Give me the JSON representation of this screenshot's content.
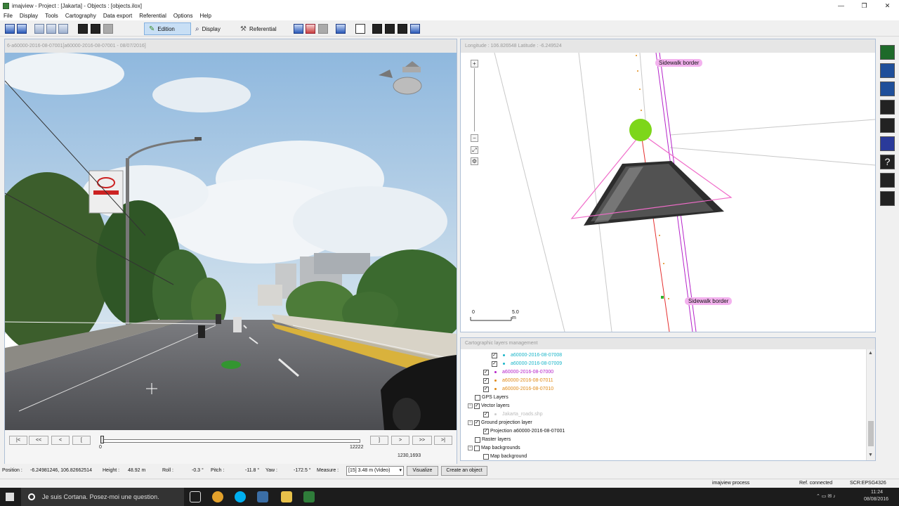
{
  "window": {
    "title": "imajview - Project : [Jakarta] - Objects : [objects.ilox]",
    "controls": [
      "—",
      "❐",
      "✕"
    ]
  },
  "menu": [
    "File",
    "Display",
    "Tools",
    "Cartography",
    "Data export",
    "Referential",
    "Options",
    "Help"
  ],
  "toolbar": {
    "edition_label": "Edition",
    "display_label": "Display",
    "referential_label": "Referential"
  },
  "left_panel": {
    "header": "6-a60000-2016-08-07001[a60000-2016-08-07001 - 08/07/2016]",
    "nav": [
      "|<",
      "<<",
      "<",
      "[",
      "]",
      ">",
      ">>",
      ">|"
    ],
    "slider_min": "0",
    "slider_max": "12222",
    "coords": "1230,1693",
    "frame_progress": 0.0
  },
  "map_panel": {
    "header": "Longitude : 106.826548 Latitude : -6.249524",
    "labels": [
      "Sidewalk border",
      "Sidewalk border"
    ],
    "scale_start": "0",
    "scale_end": "5.0",
    "scale_unit": "m"
  },
  "layers": {
    "header": "Cartographic layers management",
    "rows": [
      {
        "text": "a60000-2016-08-07008",
        "checked": true,
        "color": "#19b5c9"
      },
      {
        "text": "a60000-2016-08-07009",
        "checked": true,
        "color": "#19b5c9"
      },
      {
        "text": "a60000-2016-08-07000",
        "checked": true,
        "color": "#b522c9"
      },
      {
        "text": "a60000-2016-08-07011",
        "checked": true,
        "color": "#e08a16"
      },
      {
        "text": "a60000-2016-08-07010",
        "checked": true,
        "color": "#e08a16"
      },
      {
        "text": "GPS Layers",
        "checked": false
      },
      {
        "text": "Vector layers",
        "checked": true
      },
      {
        "text": "Jakarta_roads.shp",
        "checked": true,
        "color": "#bbbbbb"
      },
      {
        "text": "Ground projection layer",
        "checked": true
      },
      {
        "text": "Projection a60000-2016-08-07001",
        "checked": true
      },
      {
        "text": "Raster layers",
        "checked": false
      },
      {
        "text": "Map backgrounds",
        "checked": false
      },
      {
        "text": "Map background",
        "checked": false
      }
    ]
  },
  "status": {
    "position_label": "Position :",
    "position_value": "-6.24981246, 106.82662514",
    "height_label": "Height :",
    "height_value": "48.92 m",
    "roll_label": "Roll :",
    "roll_value": "-0.3 °",
    "pitch_label": "Pitch :",
    "pitch_value": "-11.8 °",
    "yaw_label": "Yaw :",
    "yaw_value": "-172.5 °",
    "measure_label": "Measure :",
    "measure_value": "[15] 3.48 m (Video)",
    "visualize_label": "Visualize",
    "create_label": "Create an object"
  },
  "bottom": {
    "process": "imajview process",
    "ref": "Ref. connected",
    "scr": "SCR:EPSG4326"
  },
  "taskbar": {
    "cortana": "Je suis Cortana. Posez-moi une question.",
    "time": "11:24",
    "date": "08/08/2016"
  }
}
